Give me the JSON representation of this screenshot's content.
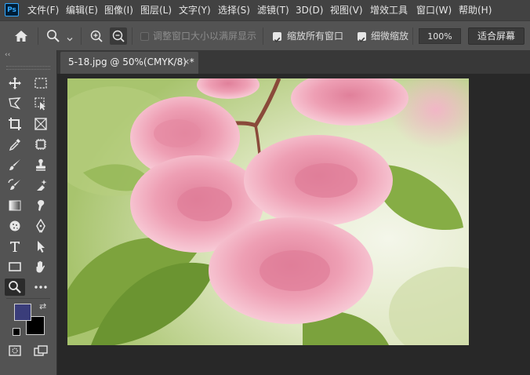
{
  "app": {
    "logo_text": "Ps"
  },
  "menu": [
    "文件(F)",
    "编辑(E)",
    "图像(I)",
    "图层(L)",
    "文字(Y)",
    "选择(S)",
    "滤镜(T)",
    "3D(D)",
    "视图(V)",
    "增效工具",
    "窗口(W)",
    "帮助(H)"
  ],
  "options": {
    "resize_windows_label": "调整窗口大小以满屏显示",
    "resize_windows_checked": false,
    "zoom_all_label": "缩放所有窗口",
    "zoom_all_checked": true,
    "scrubby_label": "细微缩放",
    "scrubby_checked": true,
    "zoom_value": "100%",
    "fit_screen_label": "适合屏幕"
  },
  "document": {
    "tab_title": "5-18.jpg @ 50%(CMYK/8) *",
    "close_glyph": "×"
  },
  "toolbar": {
    "collapse_glyph": "‹‹",
    "active_tool": "zoom",
    "foreground_color": "#3a3d7a",
    "background_color": "#000000"
  }
}
